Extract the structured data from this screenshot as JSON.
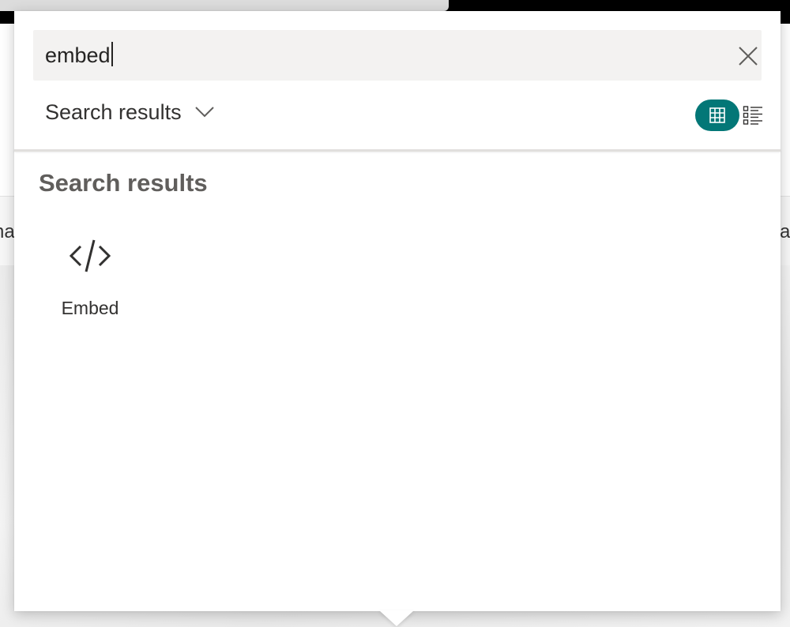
{
  "search": {
    "value": "embed",
    "clear_label": "Clear search"
  },
  "filter": {
    "selected": "Search results"
  },
  "view_toggle": {
    "grid_label": "Grid view",
    "list_label": "List view",
    "active": "grid",
    "active_color": "#037777"
  },
  "results": {
    "heading": "Search results",
    "items": [
      {
        "label": "Embed",
        "icon": "code-embed-icon"
      }
    ]
  },
  "background": {
    "strip_left_text": "na",
    "strip_right_text": "a"
  }
}
